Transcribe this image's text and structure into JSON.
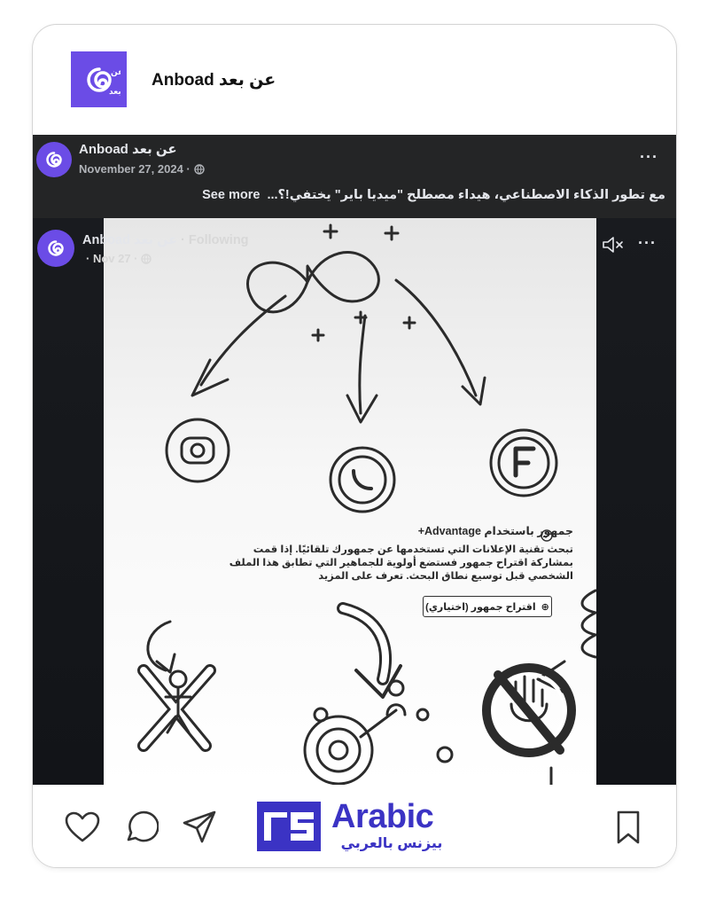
{
  "header": {
    "account_name": "Anboad عن بعد",
    "logo_icon": "anboad-logo-icon"
  },
  "fb_post": {
    "author": "Anboad عن بعد",
    "date": "November 27, 2024 ·",
    "caption": "مع تطور الذكاء الاصطناعي، هيداء مصطلح \"ميديا باير\" يختفي!؟...",
    "see_more": "See more",
    "menu_icon": "···",
    "video": {
      "author": "Anboad عن بعد",
      "following": " · Following",
      "date": "· Nov 27 ·",
      "menu_icon": "···",
      "ad_title": "جمهور باستخدام Advantage+",
      "ad_body": "تبحث تقنية الإعلانات التي تستخدمها عن جمهورك تلقائيًا. إذا قمت بمشاركة اقتراح جمهور فستضع أولوية للجماهير التي تطابق هذا الملف الشخصي قبل توسيع نطاق البحث. تعرف على المزيد",
      "ad_button": "اقتراح جمهور (اختياري)"
    }
  },
  "actions": {
    "like_icon": "heart-icon",
    "comment_icon": "comment-icon",
    "share_icon": "share-icon",
    "save_icon": "bookmark-icon"
  },
  "sponsor": {
    "word": "Arabic",
    "arabic": "بيزنس بالعربي"
  },
  "colors": {
    "brand_purple": "#6b4ce6",
    "sponsor_blue": "#3b33c4",
    "fb_dark": "#242526"
  }
}
